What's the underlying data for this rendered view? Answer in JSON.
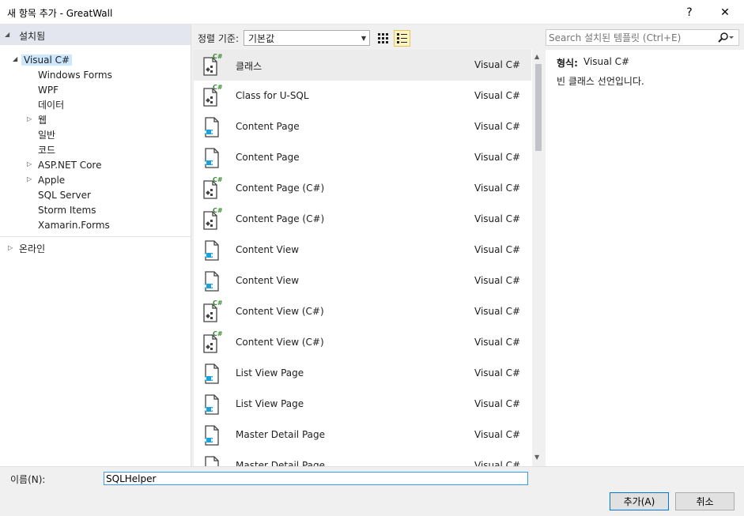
{
  "window": {
    "title": "새 항목 추가 - GreatWall",
    "help_glyph": "?",
    "close_glyph": "✕"
  },
  "sidebar": {
    "installed_label": "설치됨",
    "root_label": "Visual C#",
    "children": [
      {
        "label": "Windows Forms",
        "expandable": false
      },
      {
        "label": "WPF",
        "expandable": false
      },
      {
        "label": "데이터",
        "expandable": false
      },
      {
        "label": "웹",
        "expandable": true
      },
      {
        "label": "일반",
        "expandable": false
      },
      {
        "label": "코드",
        "expandable": false
      },
      {
        "label": "ASP.NET Core",
        "expandable": true
      },
      {
        "label": "Apple",
        "expandable": true
      },
      {
        "label": "SQL Server",
        "expandable": false
      },
      {
        "label": "Storm Items",
        "expandable": false
      },
      {
        "label": "Xamarin.Forms",
        "expandable": false
      }
    ],
    "online_label": "온라인"
  },
  "toolbar": {
    "sort_label": "정렬 기준:",
    "sort_value": "기본값"
  },
  "templates": [
    {
      "name": "클래스",
      "lang": "Visual C#",
      "icon": "csharp-class-icon",
      "selected": true
    },
    {
      "name": "Class for U-SQL",
      "lang": "Visual C#",
      "icon": "csharp-class-icon",
      "selected": false
    },
    {
      "name": "Content Page",
      "lang": "Visual C#",
      "icon": "xaml-page-icon",
      "selected": false
    },
    {
      "name": "Content Page",
      "lang": "Visual C#",
      "icon": "xaml-page-icon",
      "selected": false
    },
    {
      "name": "Content Page (C#)",
      "lang": "Visual C#",
      "icon": "csharp-class-icon",
      "selected": false
    },
    {
      "name": "Content Page (C#)",
      "lang": "Visual C#",
      "icon": "csharp-class-icon",
      "selected": false
    },
    {
      "name": "Content View",
      "lang": "Visual C#",
      "icon": "xaml-page-icon",
      "selected": false
    },
    {
      "name": "Content View",
      "lang": "Visual C#",
      "icon": "xaml-page-icon",
      "selected": false
    },
    {
      "name": "Content View (C#)",
      "lang": "Visual C#",
      "icon": "csharp-class-icon",
      "selected": false
    },
    {
      "name": "Content View (C#)",
      "lang": "Visual C#",
      "icon": "csharp-class-icon",
      "selected": false
    },
    {
      "name": "List View Page",
      "lang": "Visual C#",
      "icon": "xaml-page-icon",
      "selected": false
    },
    {
      "name": "List View Page",
      "lang": "Visual C#",
      "icon": "xaml-page-icon",
      "selected": false
    },
    {
      "name": "Master Detail Page",
      "lang": "Visual C#",
      "icon": "xaml-page-icon",
      "selected": false
    },
    {
      "name": "Master Detail Page",
      "lang": "Visual C#",
      "icon": "xaml-page-icon",
      "selected": false
    }
  ],
  "search": {
    "placeholder": "Search 설치된 템플릿 (Ctrl+E)"
  },
  "details": {
    "type_label": "형식:",
    "type_value": "Visual C#",
    "description": "빈 클래스 선언입니다."
  },
  "bottom": {
    "name_label": "이름(N):",
    "name_value": "SQLHelper",
    "add_button": "추가(A)",
    "cancel_button": "취소"
  },
  "colors": {
    "selection": "#cce8ff",
    "list_selection": "#ececec",
    "csharp_badge": "#388a34",
    "xaml_accent": "#1ba1e2"
  }
}
